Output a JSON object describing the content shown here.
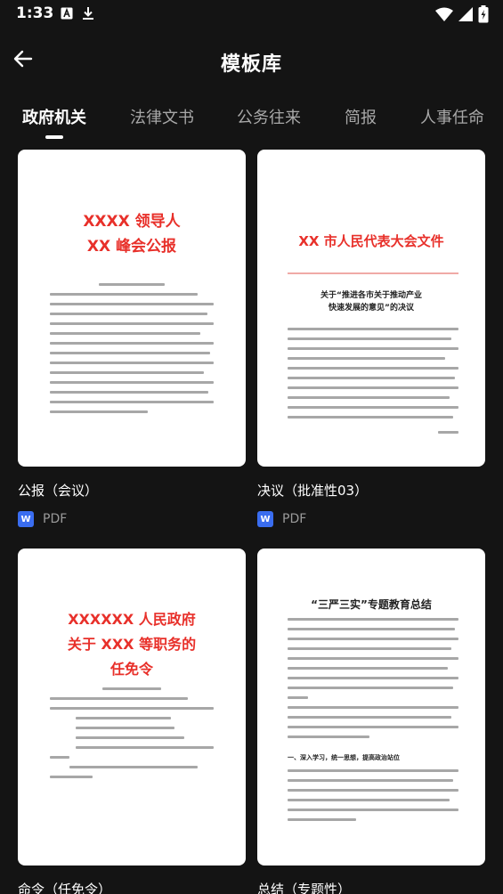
{
  "status": {
    "time": "1:33"
  },
  "header": {
    "title": "模板库"
  },
  "tabs": [
    {
      "label": "政府机关",
      "active": true
    },
    {
      "label": "法律文书"
    },
    {
      "label": "公务往来"
    },
    {
      "label": "简报"
    },
    {
      "label": "人事任命"
    }
  ],
  "templates": [
    {
      "title": "公报（会议）",
      "format": "PDF",
      "badge": "W",
      "preview": {
        "heading_line1": "XXXX 领导人",
        "heading_line2": "XX 峰会公报"
      }
    },
    {
      "title": "决议（批准性03）",
      "format": "PDF",
      "badge": "W",
      "preview": {
        "heading": "XX 市人民代表大会文件",
        "subheading_line1": "关于“推进各市关于推动产业",
        "subheading_line2": "快速发展的意见”的决议"
      }
    },
    {
      "title": "命令（任免令）",
      "preview": {
        "heading_line1": "XXXXXX 人民政府",
        "heading_line2": "关于 XXX 等职务的",
        "heading_line3": "任免令"
      }
    },
    {
      "title": "总结（专题性）",
      "preview": {
        "heading": "“三严三实”专题教育总结",
        "section": "一、深入学习，统一思想，提高政治站位"
      }
    }
  ],
  "colors": {
    "background": "#141414",
    "doc_red": "#e8302a",
    "badge_blue": "#3a6df0"
  }
}
